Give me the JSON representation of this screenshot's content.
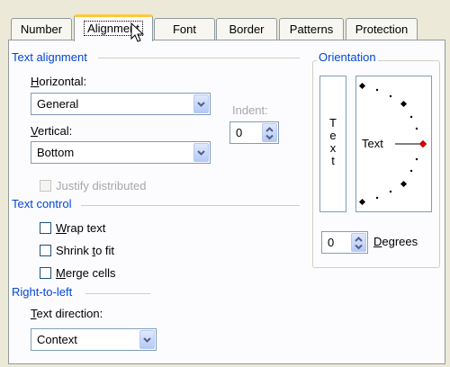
{
  "tabs": [
    "Number",
    "Alignment",
    "Font",
    "Border",
    "Patterns",
    "Protection"
  ],
  "text_alignment": {
    "title": "Text alignment",
    "horizontal_label": "Horizontal:",
    "horizontal_value": "General",
    "vertical_label": "Vertical:",
    "vertical_value": "Bottom",
    "indent_label": "Indent:",
    "indent_value": "0",
    "justify_distributed": "Justify distributed"
  },
  "text_control": {
    "title": "Text control",
    "wrap_text": "Wrap text",
    "shrink_to_fit": "Shrink to fit",
    "merge_cells": "Merge cells"
  },
  "right_to_left": {
    "title": "Right-to-left",
    "direction_label": "Text direction:",
    "direction_value": "Context"
  },
  "orientation": {
    "title": "Orientation",
    "vertical_letters": [
      "T",
      "e",
      "x",
      "t"
    ],
    "dial_text": "Text",
    "degrees_value": "0",
    "degrees_label": "Degrees"
  },
  "colors": {
    "section_title": "#0046d5",
    "active_tab_accent": "#ffc83c",
    "dial_marker": "#cc0000"
  }
}
